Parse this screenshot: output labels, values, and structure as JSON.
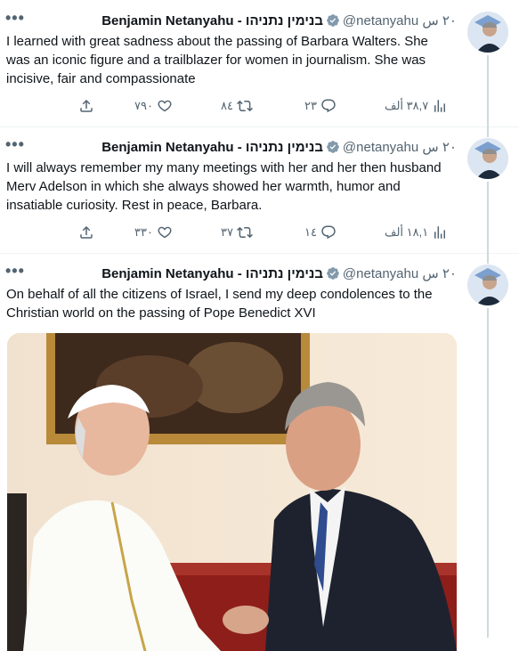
{
  "tweets": [
    {
      "name": "Benjamin Netanyahu - בנימין נתניהו",
      "handle": "@netanyahu",
      "time": "٢٠ س",
      "text": "I learned with great sadness about the passing of Barbara Walters.  She was an iconic figure and a trailblazer for women in journalism. She was incisive, fair and compassionate",
      "views": "٣٨,٧ ألف",
      "replies": "٢٣",
      "retweets": "٨٤",
      "likes": "٧٩٠"
    },
    {
      "name": "Benjamin Netanyahu - בנימין נתניהו",
      "handle": "@netanyahu",
      "time": "٢٠ س",
      "text": "I will always remember my many meetings with her and her then husband Merv Adelson in which she always showed her warmth, humor and insatiable curiosity.  Rest in peace, Barbara.",
      "views": "١٨,١ ألف",
      "replies": "١٤",
      "retweets": "٣٧",
      "likes": "٣٣٠"
    },
    {
      "name": "Benjamin Netanyahu - בנימין נתניהו",
      "handle": "@netanyahu",
      "time": "٢٠ س",
      "text": "On behalf of all the citizens of Israel, I send my deep condolences to the Christian world on the passing of Pope Benedict XVI"
    }
  ],
  "colors": {
    "verified": "#829aab",
    "text": "#0f1419",
    "muted": "#536471",
    "line": "#cfd9de"
  },
  "icons": [
    "more-icon",
    "verified-icon",
    "share-icon",
    "like-icon",
    "retweet-icon",
    "reply-icon",
    "views-icon"
  ]
}
